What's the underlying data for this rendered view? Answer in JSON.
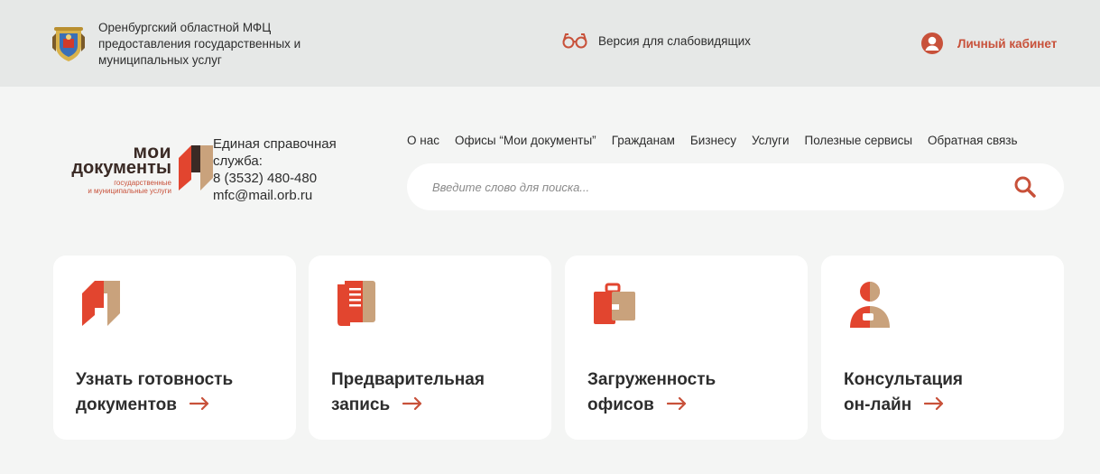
{
  "header": {
    "org_title_line1": "Оренбургский областной МФЦ",
    "org_title_line2": "предоставления государственных и",
    "org_title_line3": "муниципальных услуг",
    "accessibility_label": "Версия для слабовидящих",
    "cabinet_label": "Личный кабинет"
  },
  "logo": {
    "word_top": "мои",
    "word_main": "документы",
    "sub_line1": "государственные",
    "sub_line2": "и муниципальные услуги"
  },
  "hotline": {
    "title_line1": "Единая справочная",
    "title_line2": "служба:",
    "phone": "8 (3532) 480-480",
    "email": "mfc@mail.orb.ru"
  },
  "nav": [
    {
      "label": "О нас"
    },
    {
      "label": "Офисы “Мои документы”"
    },
    {
      "label": "Гражданам"
    },
    {
      "label": "Бизнесу"
    },
    {
      "label": "Услуги"
    },
    {
      "label": "Полезные сервисы"
    },
    {
      "label": "Обратная связь"
    }
  ],
  "search": {
    "placeholder": "Введите слово для поиска..."
  },
  "cards": [
    {
      "line1": "Узнать готовность",
      "line2": "документов"
    },
    {
      "line1": "Предварительная",
      "line2": "запись"
    },
    {
      "line1": "Загруженность",
      "line2": "офисов"
    },
    {
      "line1": "Консультация",
      "line2": "он-лайн"
    }
  ],
  "colors": {
    "accent": "#c8513a",
    "accent_red": "#e2452f",
    "accent_tan": "#c9a27c",
    "topbar_bg": "#e6e8e7",
    "page_bg": "#f4f5f4"
  }
}
